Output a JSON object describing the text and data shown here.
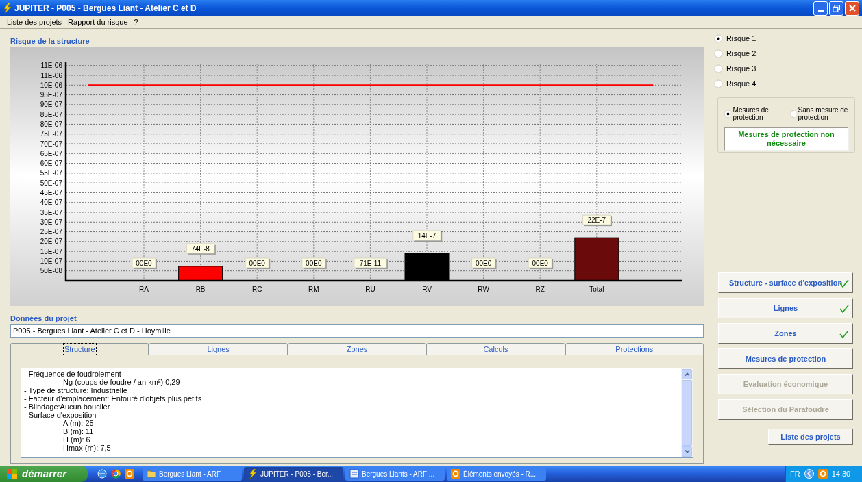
{
  "window": {
    "title": "JUPITER - P005 -  Bergues Liant - Atelier C et D"
  },
  "menu": [
    "Liste des projets",
    "Rapport du risque",
    "?"
  ],
  "chart_section": {
    "title": "Risque de la structure",
    "chart_data": {
      "type": "bar",
      "categories": [
        "RA",
        "RB",
        "RC",
        "RM",
        "RU",
        "RV",
        "RW",
        "RZ",
        "Total"
      ],
      "values": [
        0,
        7.4e-07,
        0,
        0,
        7.1e-10,
        1.4e-06,
        0,
        0,
        2.2e-06
      ],
      "colors": [
        null,
        "#ff0000",
        null,
        null,
        null,
        "#000000",
        null,
        null,
        "#6b0a0a"
      ],
      "grid": true,
      "value_labels": [
        "00E0",
        "74E-8",
        "00E0",
        "00E0",
        "71E-11",
        "14E-7",
        "00E0",
        "00E0",
        "22E-7"
      ],
      "ylim": [
        0,
        1.12e-05
      ],
      "yticks": [
        {
          "value": 5e-07,
          "label": "50E-08"
        },
        {
          "value": 1e-06,
          "label": "10E-07"
        },
        {
          "value": 1.5e-06,
          "label": "15E-07"
        },
        {
          "value": 2e-06,
          "label": "20E-07"
        },
        {
          "value": 2.5e-06,
          "label": "25E-07"
        },
        {
          "value": 3e-06,
          "label": "30E-07"
        },
        {
          "value": 3.5e-06,
          "label": "35E-07"
        },
        {
          "value": 4e-06,
          "label": "40E-07"
        },
        {
          "value": 4.5e-06,
          "label": "45E-07"
        },
        {
          "value": 5e-06,
          "label": "50E-07"
        },
        {
          "value": 5.5e-06,
          "label": "55E-07"
        },
        {
          "value": 6e-06,
          "label": "60E-07"
        },
        {
          "value": 6.5e-06,
          "label": "65E-07"
        },
        {
          "value": 7e-06,
          "label": "70E-07"
        },
        {
          "value": 7.5e-06,
          "label": "75E-07"
        },
        {
          "value": 8e-06,
          "label": "80E-07"
        },
        {
          "value": 8.5e-06,
          "label": "85E-07"
        },
        {
          "value": 9e-06,
          "label": "90E-07"
        },
        {
          "value": 9.5e-06,
          "label": "95E-07"
        },
        {
          "value": 1e-05,
          "label": "10E-06"
        },
        {
          "value": 1.05e-05,
          "label": "11E-06"
        },
        {
          "value": 1.1e-05,
          "label": "11E-06"
        }
      ],
      "ref_lines": [
        {
          "axis": "y",
          "value": 1e-05,
          "color": "#ff0000"
        }
      ]
    }
  },
  "project": {
    "title": "Données du projet",
    "value": "P005 - Bergues Liant - Atelier C et D - Hoymille"
  },
  "tabs": [
    {
      "label": "Structure",
      "selected": true
    },
    {
      "label": "Lignes",
      "selected": false
    },
    {
      "label": "Zones",
      "selected": false
    },
    {
      "label": "Calculs",
      "selected": false
    },
    {
      "label": "Protections",
      "selected": false
    }
  ],
  "details": [
    {
      "text": "- Fréquence de foudroiement",
      "children": [
        {
          "text": "Ng (coups de foudre / an km²):0,29"
        }
      ]
    },
    {
      "text": "- Type de structure: Industrielle"
    },
    {
      "text": "- Facteur d'emplacement: Entouré d'objets plus petits"
    },
    {
      "text": "- Blindage:Aucun bouclier"
    },
    {
      "text": "- Surface d'exposition",
      "children": [
        {
          "text": "A (m): 25"
        },
        {
          "text": "B (m): 11"
        },
        {
          "text": "H (m): 6"
        },
        {
          "text": "Hmax (m): 7,5"
        }
      ]
    }
  ],
  "risks": [
    {
      "label": "Risque 1",
      "selected": true
    },
    {
      "label": "Risque 2",
      "selected": false
    },
    {
      "label": "Risque 3",
      "selected": false
    },
    {
      "label": "Risque 4",
      "selected": false
    }
  ],
  "protection_options": [
    {
      "label": "Mesures de protection",
      "selected": true
    },
    {
      "label": "Sans mesure de protection",
      "selected": false
    }
  ],
  "protection_message": "Mesures de protection non nécessaire",
  "steps": [
    {
      "label": "Structure - surface d'exposition",
      "done": true,
      "disabled": false
    },
    {
      "label": "Lignes",
      "done": true,
      "disabled": false
    },
    {
      "label": "Zones",
      "done": true,
      "disabled": false
    },
    {
      "label": "Mesures de protection",
      "done": false,
      "disabled": false
    },
    {
      "label": "Evaluation économique",
      "done": false,
      "disabled": true
    },
    {
      "label": "Sélection du Parafoudre",
      "done": false,
      "disabled": true
    }
  ],
  "footer_button": "Liste des projets",
  "taskbar": {
    "start": "démarrer",
    "tasks": [
      {
        "label": "Bergues Liant - ARF",
        "kind": "folder",
        "selected": false
      },
      {
        "label": "JUPITER - P005 - Ber...",
        "kind": "app",
        "selected": true
      },
      {
        "label": "Bergues Liants - ARF ...",
        "kind": "document",
        "selected": false
      },
      {
        "label": "Éléments envoyés - R...",
        "kind": "mail",
        "selected": false
      }
    ],
    "language": "FR",
    "clock": "14:30"
  }
}
